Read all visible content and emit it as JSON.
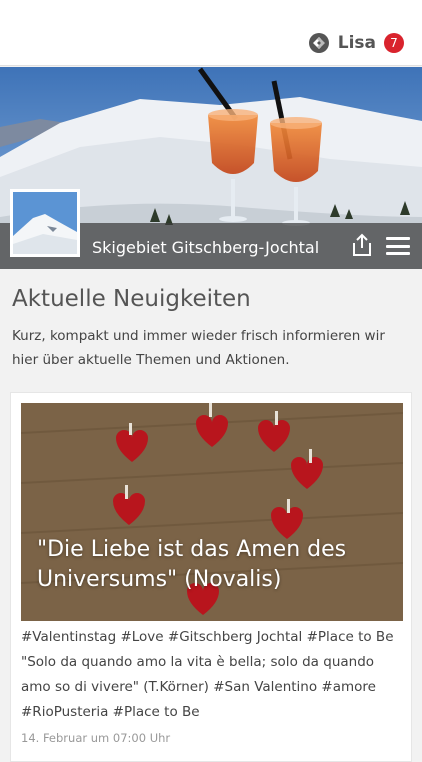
{
  "header": {
    "user_name": "Lisa",
    "notification_count": "7",
    "user_icon": "app-logo-icon"
  },
  "hero": {
    "title": "Skigebiet Gitschberg-Jochtal"
  },
  "section": {
    "title": "Aktuelle Neuigkeiten",
    "description": "Kurz, kompakt und immer wieder frisch informieren wir hier über aktuelle Themen und Aktionen."
  },
  "post": {
    "quote": "\"Die Liebe ist das Amen des Universums\" (Novalis)",
    "text": "#Valentinstag #Love #Gitschberg Jochtal #Place to Be \"Solo da quando amo la vita è bella; solo da quando amo so di vivere\" (T.Körner) #San Valentino #amore #RioPusteria #Place to Be",
    "date": "14. Februar um 07:00 Uhr"
  },
  "colors": {
    "badge": "#d9232d",
    "bar": "#3c3c3c"
  }
}
